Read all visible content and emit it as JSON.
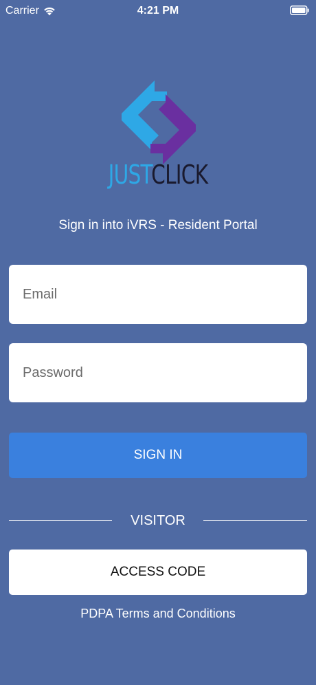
{
  "status_bar": {
    "carrier": "Carrier",
    "time": "4:21 PM",
    "wifi_icon": "wifi-icon",
    "battery_icon": "battery-icon"
  },
  "brand": {
    "logo_icon": "justclick-logo-icon",
    "name_part1": "JUST",
    "name_part2": "CLICK",
    "color_part1": "#2ea8e6",
    "color_part2": "#1a1a2e"
  },
  "subtitle": "Sign in into iVRS - Resident Portal",
  "form": {
    "email_placeholder": "Email",
    "email_value": "",
    "password_placeholder": "Password",
    "password_value": "",
    "sign_in_label": "SIGN IN"
  },
  "visitor": {
    "label": "VISITOR",
    "access_code_label": "ACCESS CODE"
  },
  "terms_link": "PDPA Terms and Conditions",
  "colors": {
    "background": "#4f6aa3",
    "primary_button": "#3a80de",
    "logo_blue": "#2ea8e6",
    "logo_purple": "#6a2fa0"
  }
}
